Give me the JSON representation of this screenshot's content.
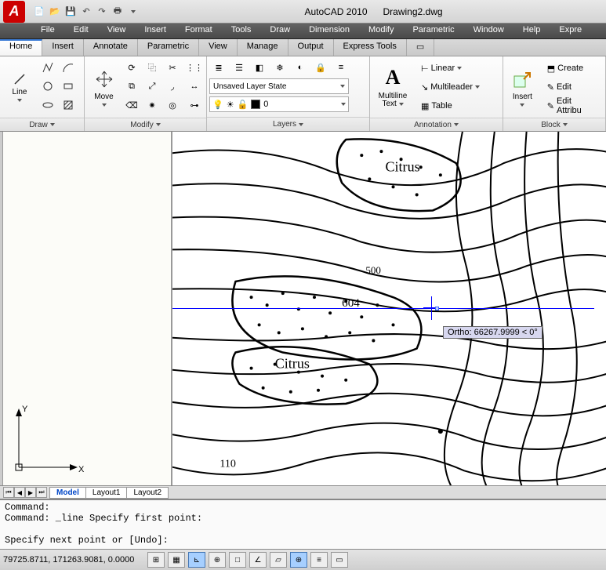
{
  "app": {
    "name": "AutoCAD 2010",
    "file": "Drawing2.dwg",
    "icon_letter": "A"
  },
  "qat": [
    "new",
    "open",
    "save",
    "undo",
    "redo",
    "print",
    "more"
  ],
  "menubar": [
    "File",
    "Edit",
    "View",
    "Insert",
    "Format",
    "Tools",
    "Draw",
    "Dimension",
    "Modify",
    "Parametric",
    "Window",
    "Help",
    "Expre"
  ],
  "tabs": [
    "Home",
    "Insert",
    "Annotate",
    "Parametric",
    "View",
    "Manage",
    "Output",
    "Express Tools"
  ],
  "active_tab": 0,
  "ribbon": {
    "draw": {
      "label": "Draw",
      "line_label": "Line"
    },
    "modify": {
      "label": "Modify",
      "move_label": "Move"
    },
    "layers": {
      "label": "Layers",
      "state": "Unsaved Layer State",
      "current": "0"
    },
    "annotation": {
      "label": "Annotation",
      "ml_top": "Multiline",
      "ml_bot": "Text",
      "linear": "Linear",
      "multileader": "Multileader",
      "table": "Table"
    },
    "block": {
      "label": "Block",
      "insert": "Insert",
      "create": "Create",
      "edit": "Edit",
      "editattr": "Edit Attribu"
    }
  },
  "tooltip": "Ortho: 66267.9999 < 0°",
  "map_labels": {
    "t1": "Citrus",
    "t2": "Citrus",
    "n604": "604",
    "n500": "500",
    "n110": "110"
  },
  "axis": {
    "x": "X",
    "y": "Y"
  },
  "sheets": [
    "Model",
    "Layout1",
    "Layout2"
  ],
  "cmd": {
    "l1": "Command:",
    "l2": "Command: _line Specify first point:",
    "l3": " ",
    "l4": "Specify next point or [Undo]:"
  },
  "status": {
    "coords": "79725.8711, 171263.9081, 0.0000"
  }
}
